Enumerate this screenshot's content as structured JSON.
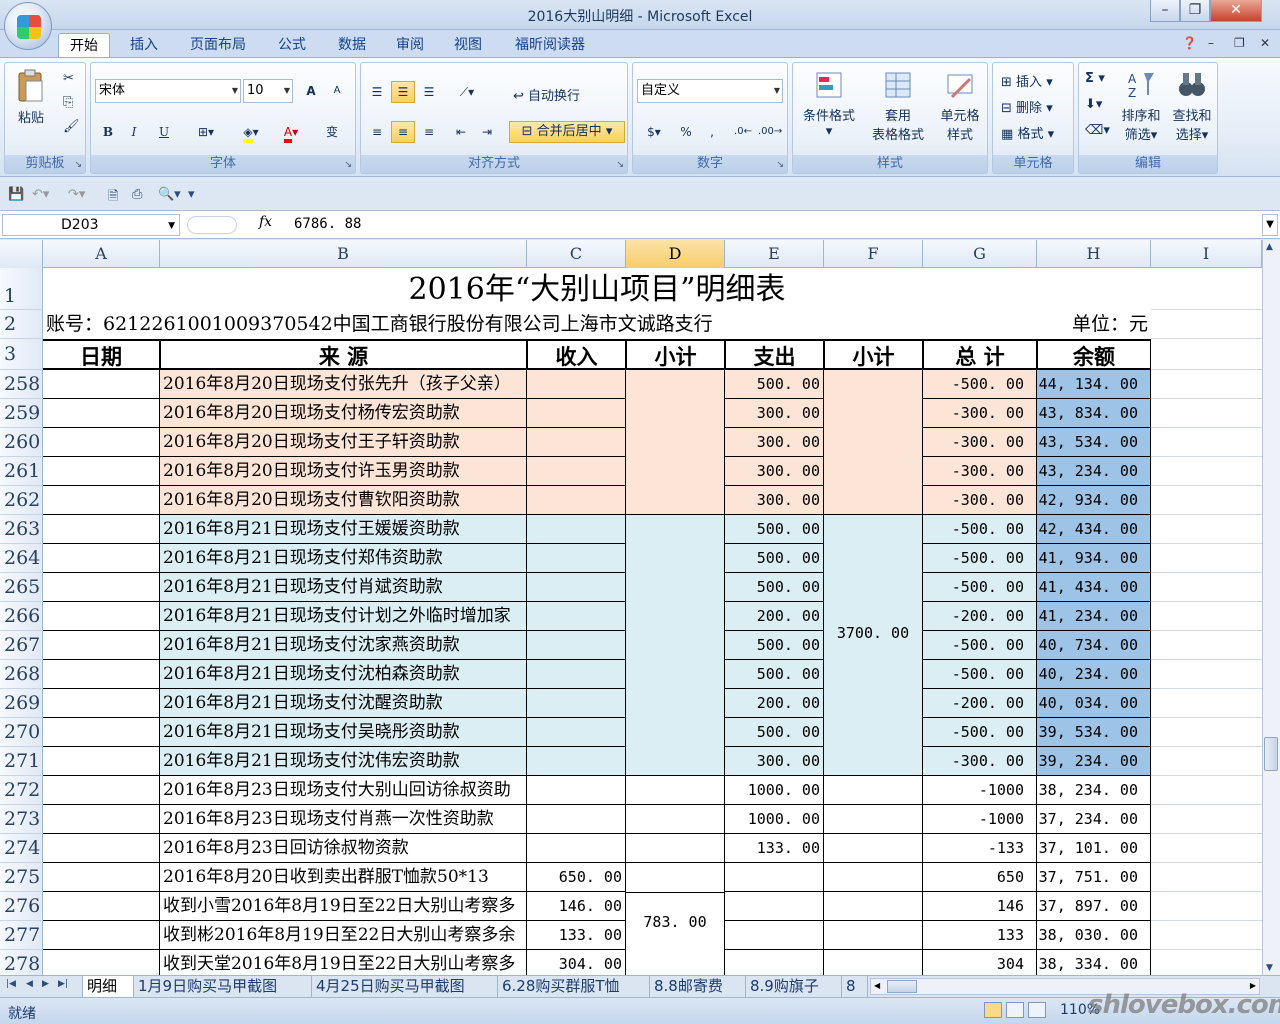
{
  "window": {
    "title": "2016大别山明细 - Microsoft Excel",
    "minimize": "–",
    "maximize": "❐",
    "close": "✕"
  },
  "ribbon_tabs": [
    "开始",
    "插入",
    "页面布局",
    "公式",
    "数据",
    "审阅",
    "视图",
    "福昕阅读器"
  ],
  "ribbon": {
    "clipboard": {
      "label": "剪贴板",
      "paste": "粘贴"
    },
    "font": {
      "label": "字体",
      "name": "宋体",
      "size": "10",
      "bold": "B",
      "italic": "I",
      "underline": "U",
      "grow": "A",
      "shrink": "A",
      "phonetic": "变"
    },
    "alignment": {
      "label": "对齐方式",
      "wrap": "自动换行",
      "merge": "合并后居中"
    },
    "number": {
      "label": "数字",
      "format": "自定义",
      "percent": "%",
      "comma": ","
    },
    "styles": {
      "label": "样式",
      "conditional": "条件格式",
      "table_1": "套用",
      "table_2": "表格格式",
      "cell_1": "单元格",
      "cell_2": "样式"
    },
    "cells": {
      "label": "单元格",
      "insert": "插入",
      "delete": "删除",
      "format": "格式"
    },
    "editing": {
      "label": "编辑",
      "sum": "Σ",
      "sort_1": "排序和",
      "sort_2": "筛选",
      "find_1": "查找和",
      "find_2": "选择"
    }
  },
  "formula_bar": {
    "name_box": "D203",
    "fx": "fx",
    "content": "6786. 88"
  },
  "columns": [
    "A",
    "B",
    "C",
    "D",
    "E",
    "F",
    "G",
    "H",
    "I"
  ],
  "selected_column": "D",
  "sheet": {
    "title": "2016年“大别山项目”明细表",
    "account": "账号：6212261001009370542中国工商银行股份有限公司上海市文诚路支行",
    "unit": "单位：元",
    "headers": [
      "日期",
      "来 源",
      "收入",
      "小计",
      "支出",
      "小计",
      "总 计",
      "余额"
    ],
    "rows": [
      {
        "row": "258",
        "source": "2016年8月20日现场支付张先升（孩子父亲）",
        "income": "",
        "expense": "500. 00",
        "total": "-500. 00",
        "balance": "44, 134. 00",
        "band": "peach"
      },
      {
        "row": "259",
        "source": "2016年8月20日现场支付杨传宏资助款",
        "income": "",
        "expense": "300. 00",
        "total": "-300. 00",
        "balance": "43, 834. 00",
        "band": "peach"
      },
      {
        "row": "260",
        "source": "2016年8月20日现场支付王子轩资助款",
        "income": "",
        "expense": "300. 00",
        "total": "-300. 00",
        "balance": "43, 534. 00",
        "band": "peach"
      },
      {
        "row": "261",
        "source": "2016年8月20日现场支付许玉男资助款",
        "income": "",
        "expense": "300. 00",
        "total": "-300. 00",
        "balance": "43, 234. 00",
        "band": "peach"
      },
      {
        "row": "262",
        "source": "2016年8月20日现场支付曹钦阳资助款",
        "income": "",
        "expense": "300. 00",
        "total": "-300. 00",
        "balance": "42, 934. 00",
        "band": "peach"
      },
      {
        "row": "263",
        "source": "2016年8月21日现场支付王媛媛资助款",
        "income": "",
        "expense": "500. 00",
        "total": "-500. 00",
        "balance": "42, 434. 00",
        "band": "blue"
      },
      {
        "row": "264",
        "source": "2016年8月21日现场支付郑伟资助款",
        "income": "",
        "expense": "500. 00",
        "total": "-500. 00",
        "balance": "41, 934. 00",
        "band": "blue"
      },
      {
        "row": "265",
        "source": "2016年8月21日现场支付肖斌资助款",
        "income": "",
        "expense": "500. 00",
        "total": "-500. 00",
        "balance": "41, 434. 00",
        "band": "blue"
      },
      {
        "row": "266",
        "source": "2016年8月21日现场支付计划之外临时增加家",
        "income": "",
        "expense": "200. 00",
        "total": "-200. 00",
        "balance": "41, 234. 00",
        "band": "blue"
      },
      {
        "row": "267",
        "source": "2016年8月21日现场支付沈家燕资助款",
        "income": "",
        "expense": "500. 00",
        "total": "-500. 00",
        "balance": "40, 734. 00",
        "band": "blue"
      },
      {
        "row": "268",
        "source": "2016年8月21日现场支付沈柏森资助款",
        "income": "",
        "expense": "500. 00",
        "total": "-500. 00",
        "balance": "40, 234. 00",
        "band": "blue"
      },
      {
        "row": "269",
        "source": "2016年8月21日现场支付沈醒资助款",
        "income": "",
        "expense": "200. 00",
        "total": "-200. 00",
        "balance": "40, 034. 00",
        "band": "blue"
      },
      {
        "row": "270",
        "source": "2016年8月21日现场支付吴晓彤资助款",
        "income": "",
        "expense": "500. 00",
        "total": "-500. 00",
        "balance": "39, 534. 00",
        "band": "blue"
      },
      {
        "row": "271",
        "source": "2016年8月21日现场支付沈伟宏资助款",
        "income": "",
        "expense": "300. 00",
        "total": "-300. 00",
        "balance": "39, 234. 00",
        "band": "blue"
      },
      {
        "row": "272",
        "source": "2016年8月23日现场支付大别山回访徐叔资助",
        "income": "",
        "expense": "1000. 00",
        "total": "-1000",
        "balance": "38, 234. 00",
        "band": ""
      },
      {
        "row": "273",
        "source": "2016年8月23日现场支付肖燕一次性资助款",
        "income": "",
        "expense": "1000. 00",
        "total": "-1000",
        "balance": "37, 234. 00",
        "band": ""
      },
      {
        "row": "274",
        "source": "2016年8月23日回访徐叔物资款",
        "income": "",
        "expense": "133. 00",
        "total": "-133",
        "balance": "37, 101. 00",
        "band": ""
      },
      {
        "row": "275",
        "source": "2016年8月20日收到卖出群服T恤款50*13",
        "income": "650. 00",
        "expense": "",
        "total": "650",
        "balance": "37, 751. 00",
        "band": ""
      },
      {
        "row": "276",
        "source": "收到小雪2016年8月19日至22日大别山考察多",
        "income": "146. 00",
        "expense": "",
        "total": "146",
        "balance": "37, 897. 00",
        "band": ""
      },
      {
        "row": "277",
        "source": "收到彬2016年8月19日至22日大别山考察多余",
        "income": "133. 00",
        "expense": "",
        "total": "133",
        "balance": "38, 030. 00",
        "band": ""
      },
      {
        "row": "278",
        "source": "收到天堂2016年8月19日至22日大别山考察多",
        "income": "304. 00",
        "expense": "",
        "total": "304",
        "balance": "38, 334. 00",
        "band": ""
      }
    ],
    "merged": {
      "f_blue_subtotal": "3700. 00",
      "d_income_subtotal": "783. 00"
    }
  },
  "sheet_tabs": [
    "明细",
    "1月9日购买马甲截图",
    "4月25日购买马甲截图",
    "6.28购买群服T恤",
    "8.8邮寄费",
    "8.9购旗子",
    "8"
  ],
  "status": {
    "ready": "就绪",
    "zoom": "110%",
    "watermark": "shlovebox.com"
  }
}
